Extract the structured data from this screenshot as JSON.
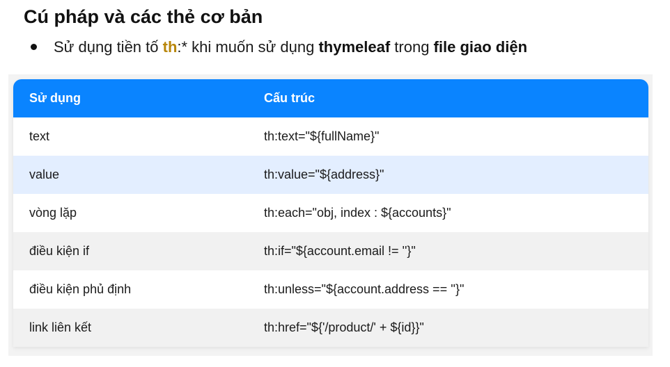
{
  "title": "Cú pháp và các thẻ cơ bản",
  "bullet": {
    "part1": "Sử dụng tiền tố ",
    "prefix": "th",
    "part2": ":* khi muốn sử dụng ",
    "bold1": "thymeleaf",
    "part3": " trong ",
    "bold2": "file giao diện"
  },
  "table": {
    "headers": [
      "Sử dụng",
      "Cấu trúc"
    ],
    "rows": [
      {
        "usage": "text",
        "syntax": "th:text=\"${fullName}\""
      },
      {
        "usage": "value",
        "syntax": "th:value=\"${address}\""
      },
      {
        "usage": "vòng lặp",
        "syntax": "th:each=\"obj, index : ${accounts}\""
      },
      {
        "usage": "điều kiện if",
        "syntax": "th:if=\"${account.email != ''}\""
      },
      {
        "usage": "điều kiện phủ định",
        "syntax": "th:unless=\"${account.address == ''}\""
      },
      {
        "usage": "link liên kết",
        "syntax": "th:href=\"${'/product/' + ${id}}\""
      }
    ]
  },
  "colors": {
    "header_bg": "#0a84ff",
    "accent": "#b8860b",
    "row_highlight": "#e3eeff"
  }
}
